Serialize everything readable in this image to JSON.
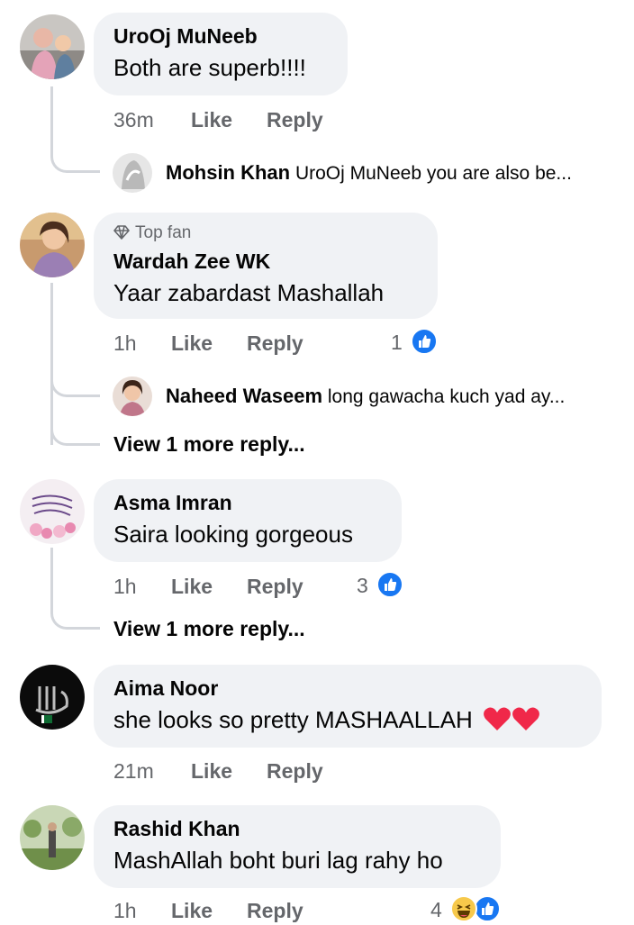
{
  "colors": {
    "bubble": "#f0f2f5",
    "meta": "#65676b",
    "like_blue": "#1877f2",
    "heart_red": "#f02849"
  },
  "comments": [
    {
      "author": "UroOj MuNeeb",
      "text": "Both are superb!!!!",
      "time": "36m",
      "like_label": "Like",
      "reply_label": "Reply",
      "replies": [
        {
          "author": "Mohsin Khan",
          "text": "UroOj MuNeeb you are also be..."
        }
      ]
    },
    {
      "badge_icon": "diamond-icon",
      "badge": "Top fan",
      "author": "Wardah Zee WK",
      "text": "Yaar zabardast Mashallah",
      "time": "1h",
      "like_label": "Like",
      "reply_label": "Reply",
      "reaction_count": "1",
      "reactions": [
        "like-icon"
      ],
      "replies": [
        {
          "author": "Naheed Waseem",
          "text": "long gawacha kuch yad ay..."
        }
      ],
      "more_replies": "View 1 more reply..."
    },
    {
      "author": "Asma Imran",
      "text": "Saira looking gorgeous",
      "time": "1h",
      "like_label": "Like",
      "reply_label": "Reply",
      "reaction_count": "3",
      "reactions": [
        "like-icon"
      ],
      "more_replies": "View 1 more reply..."
    },
    {
      "author": "Aima Noor",
      "text": "she looks so pretty MASHAALLAH",
      "text_emoji": [
        "heart-icon",
        "heart-icon"
      ],
      "time": "21m",
      "like_label": "Like",
      "reply_label": "Reply"
    },
    {
      "author": "Rashid Khan",
      "text": "MashAllah boht buri lag rahy ho",
      "time": "1h",
      "like_label": "Like",
      "reply_label": "Reply",
      "reaction_count": "4",
      "reactions": [
        "haha-icon",
        "like-icon"
      ]
    }
  ]
}
